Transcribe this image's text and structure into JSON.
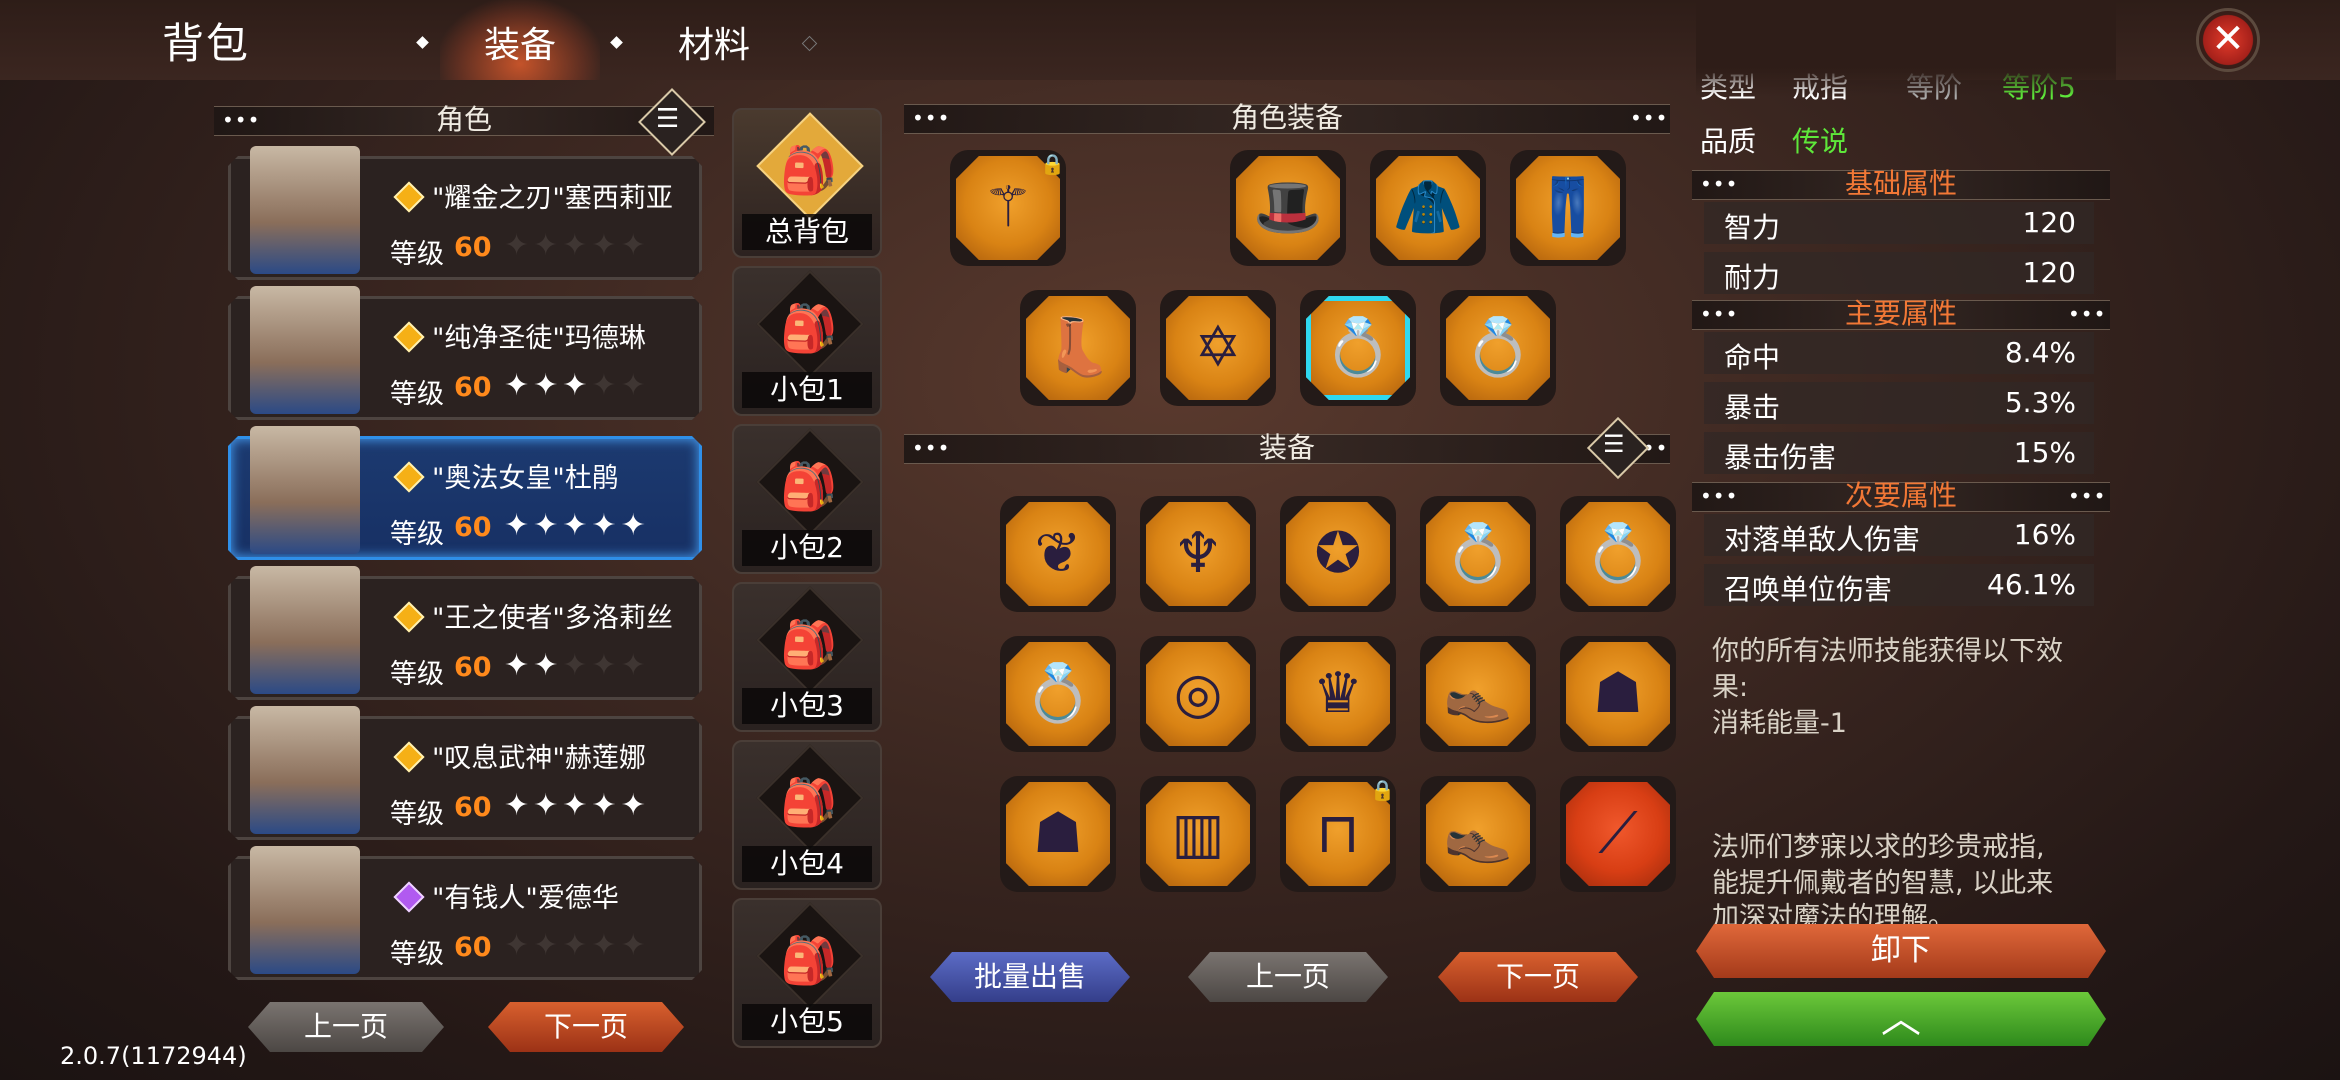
{
  "header": {
    "title": "背包",
    "tabs": [
      {
        "label": "装备",
        "active": true
      },
      {
        "label": "材料",
        "active": false
      }
    ],
    "close_icon": "close-icon"
  },
  "left": {
    "section_title": "角色",
    "characters": [
      {
        "name": "\"耀金之刃\"塞西莉亚",
        "level_label": "等级",
        "level": "60",
        "stars_on": 0,
        "gem": "gold"
      },
      {
        "name": "\"纯净圣徒\"玛德琳",
        "level_label": "等级",
        "level": "60",
        "stars_on": 3,
        "gem": "gold"
      },
      {
        "name": "\"奥法女皇\"杜鹃",
        "level_label": "等级",
        "level": "60",
        "stars_on": 5,
        "gem": "gold",
        "selected": true
      },
      {
        "name": "\"王之使者\"多洛莉丝",
        "level_label": "等级",
        "level": "60",
        "stars_on": 2,
        "gem": "gold"
      },
      {
        "name": "\"叹息武神\"赫莲娜",
        "level_label": "等级",
        "level": "60",
        "stars_on": 5,
        "gem": "gold"
      },
      {
        "name": "\"有钱人\"爱德华",
        "level_label": "等级",
        "level": "60",
        "stars_on": 0,
        "gem": "purple"
      }
    ],
    "prev_label": "上一页",
    "next_label": "下一页"
  },
  "bags": [
    {
      "label": "总背包",
      "active": true
    },
    {
      "label": "小包1"
    },
    {
      "label": "小包2"
    },
    {
      "label": "小包3"
    },
    {
      "label": "小包4"
    },
    {
      "label": "小包5"
    }
  ],
  "middle": {
    "equipped_title": "角色装备",
    "inventory_title": "装备",
    "bulk_sell_label": "批量出售",
    "prev_label": "上一页",
    "next_label": "下一页"
  },
  "right": {
    "type_label": "类型",
    "type_value": "戒指",
    "level_label": "等阶",
    "level_value": "等阶5",
    "quality_label": "品质",
    "quality_value": "传说",
    "quality_color": "#5ee83a",
    "basic_title": "基础属性",
    "basic": [
      {
        "name": "智力",
        "value": "120"
      },
      {
        "name": "耐力",
        "value": "120"
      }
    ],
    "main_title": "主要属性",
    "main": [
      {
        "name": "命中",
        "value": "8.4%"
      },
      {
        "name": "暴击",
        "value": "5.3%"
      },
      {
        "name": "暴击伤害",
        "value": "15%"
      }
    ],
    "secondary_title": "次要属性",
    "secondary": [
      {
        "name": "对落单敌人伤害",
        "value": "16%"
      },
      {
        "name": "召唤单位伤害",
        "value": "46.1%"
      }
    ],
    "effect_line1": "你的所有法师技能获得以下效",
    "effect_line2": "果:",
    "effect_line3": "消耗能量-1",
    "lore_line1": "法师们梦寐以求的珍贵戒指,",
    "lore_line2": "能提升佩戴者的智慧, 以此来",
    "lore_line3": "加深对魔法的理解。",
    "unequip_label": "卸下"
  },
  "version": "2.0.7(1172944)"
}
